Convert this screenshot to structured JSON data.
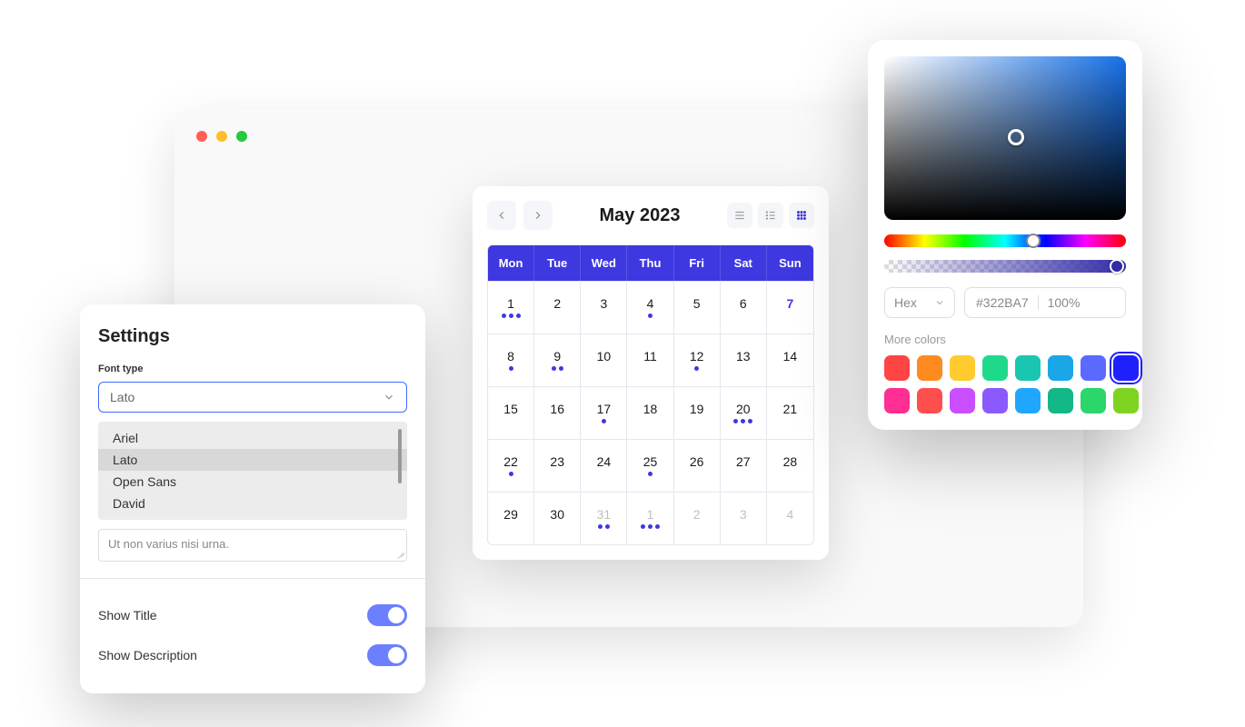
{
  "settings": {
    "title": "Settings",
    "font_label": "Font type",
    "font_selected": "Lato",
    "font_options": [
      "Ariel",
      "Lato",
      "Open Sans",
      "David"
    ],
    "textarea_value": "Ut non varius nisi urna.",
    "show_title_label": "Show Title",
    "show_title_on": true,
    "show_description_label": "Show Description",
    "show_description_on": true
  },
  "calendar": {
    "title": "May 2023",
    "weekdays": [
      "Mon",
      "Tue",
      "Wed",
      "Thu",
      "Fri",
      "Sat",
      "Sun"
    ],
    "rows": [
      [
        {
          "n": "1",
          "d": 3
        },
        {
          "n": "2",
          "d": 0
        },
        {
          "n": "3",
          "d": 0
        },
        {
          "n": "4",
          "d": 1
        },
        {
          "n": "5",
          "d": 0
        },
        {
          "n": "6",
          "d": 0
        },
        {
          "n": "7",
          "d": 0,
          "sel": true
        }
      ],
      [
        {
          "n": "8",
          "d": 1
        },
        {
          "n": "9",
          "d": 2
        },
        {
          "n": "10",
          "d": 0
        },
        {
          "n": "11",
          "d": 0
        },
        {
          "n": "12",
          "d": 1
        },
        {
          "n": "13",
          "d": 0
        },
        {
          "n": "14",
          "d": 0
        }
      ],
      [
        {
          "n": "15",
          "d": 0
        },
        {
          "n": "16",
          "d": 0
        },
        {
          "n": "17",
          "d": 1
        },
        {
          "n": "18",
          "d": 0
        },
        {
          "n": "19",
          "d": 0
        },
        {
          "n": "20",
          "d": 3
        },
        {
          "n": "21",
          "d": 0
        }
      ],
      [
        {
          "n": "22",
          "d": 1
        },
        {
          "n": "23",
          "d": 0
        },
        {
          "n": "24",
          "d": 0
        },
        {
          "n": "25",
          "d": 1
        },
        {
          "n": "26",
          "d": 0
        },
        {
          "n": "27",
          "d": 0
        },
        {
          "n": "28",
          "d": 0
        }
      ],
      [
        {
          "n": "29",
          "d": 0
        },
        {
          "n": "30",
          "d": 0
        },
        {
          "n": "31",
          "d": 2,
          "muted": true
        },
        {
          "n": "1",
          "d": 3,
          "muted": true
        },
        {
          "n": "2",
          "d": 0,
          "muted": true
        },
        {
          "n": "3",
          "d": 0,
          "muted": true
        },
        {
          "n": "4",
          "d": 0,
          "muted": true
        }
      ]
    ]
  },
  "picker": {
    "format_label": "Hex",
    "hex_value": "#322BA7",
    "opacity": "100%",
    "more_label": "More colors",
    "swatches": [
      {
        "c": "#FF4444"
      },
      {
        "c": "#FF8A1F"
      },
      {
        "c": "#FFCB2E"
      },
      {
        "c": "#1FD98B"
      },
      {
        "c": "#1BC6B0"
      },
      {
        "c": "#1BA6E8"
      },
      {
        "c": "#5A6AFF"
      },
      {
        "c": "#2020FF",
        "sel": true
      },
      {
        "c": "#FF2E93"
      },
      {
        "c": "#FF4E4E"
      },
      {
        "c": "#C94EFF"
      },
      {
        "c": "#8A5AFF"
      },
      {
        "c": "#1FA6FF"
      },
      {
        "c": "#12B886"
      },
      {
        "c": "#2BD66B"
      },
      {
        "c": "#7ED321"
      }
    ]
  }
}
